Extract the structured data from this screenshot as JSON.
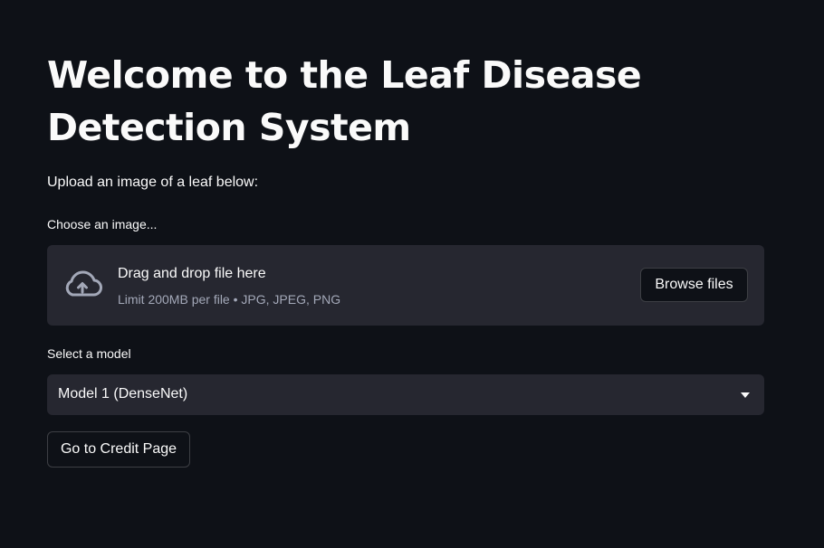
{
  "page": {
    "title": "Welcome to the Leaf Disease Detection System",
    "intro": "Upload an image of a leaf below:"
  },
  "uploader": {
    "label": "Choose an image...",
    "drop_text": "Drag and drop file here",
    "limit_text": "Limit 200MB per file • JPG, JPEG, PNG",
    "browse_label": "Browse files",
    "icon": "cloud-upload-icon"
  },
  "model_select": {
    "label": "Select a model",
    "selected": "Model 1 (DenseNet)",
    "icon": "chevron-down-icon"
  },
  "credit_button": {
    "label": "Go to Credit Page"
  },
  "colors": {
    "background": "#0e1117",
    "widget_background": "#262730",
    "text": "#fafafa",
    "muted_text": "#a3a8b8"
  }
}
